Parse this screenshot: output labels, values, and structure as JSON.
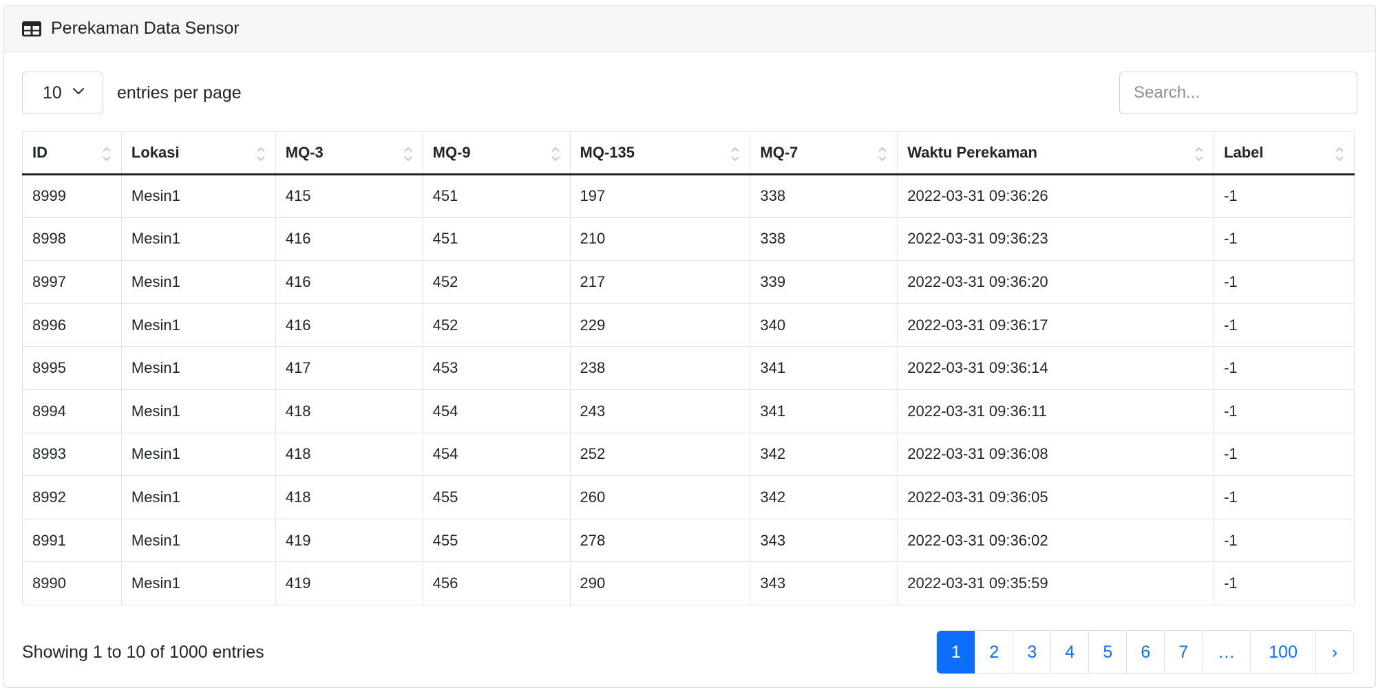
{
  "card": {
    "title": "Perekaman Data Sensor"
  },
  "controls": {
    "entries_value": "10",
    "per_page_label": "entries per page",
    "search_placeholder": "Search..."
  },
  "table": {
    "columns": [
      "ID",
      "Lokasi",
      "MQ-3",
      "MQ-9",
      "MQ-135",
      "MQ-7",
      "Waktu Perekaman",
      "Label"
    ],
    "rows": [
      [
        "8999",
        "Mesin1",
        "415",
        "451",
        "197",
        "338",
        "2022-03-31 09:36:26",
        "-1"
      ],
      [
        "8998",
        "Mesin1",
        "416",
        "451",
        "210",
        "338",
        "2022-03-31 09:36:23",
        "-1"
      ],
      [
        "8997",
        "Mesin1",
        "416",
        "452",
        "217",
        "339",
        "2022-03-31 09:36:20",
        "-1"
      ],
      [
        "8996",
        "Mesin1",
        "416",
        "452",
        "229",
        "340",
        "2022-03-31 09:36:17",
        "-1"
      ],
      [
        "8995",
        "Mesin1",
        "417",
        "453",
        "238",
        "341",
        "2022-03-31 09:36:14",
        "-1"
      ],
      [
        "8994",
        "Mesin1",
        "418",
        "454",
        "243",
        "341",
        "2022-03-31 09:36:11",
        "-1"
      ],
      [
        "8993",
        "Mesin1",
        "418",
        "454",
        "252",
        "342",
        "2022-03-31 09:36:08",
        "-1"
      ],
      [
        "8992",
        "Mesin1",
        "418",
        "455",
        "260",
        "342",
        "2022-03-31 09:36:05",
        "-1"
      ],
      [
        "8991",
        "Mesin1",
        "419",
        "455",
        "278",
        "343",
        "2022-03-31 09:36:02",
        "-1"
      ],
      [
        "8990",
        "Mesin1",
        "419",
        "456",
        "290",
        "343",
        "2022-03-31 09:35:59",
        "-1"
      ]
    ]
  },
  "footer": {
    "info": "Showing 1 to 10 of 1000 entries",
    "pages": [
      "1",
      "2",
      "3",
      "4",
      "5",
      "6",
      "7",
      "…",
      "100",
      "›"
    ],
    "active_page": "1"
  },
  "colors": {
    "accent": "#0d6efd",
    "header_bg": "#f7f7f7",
    "border": "#dee2e6"
  },
  "icons": {
    "header": "table-icon",
    "select": "chevron-down-icon",
    "sort": "sort-icon"
  }
}
